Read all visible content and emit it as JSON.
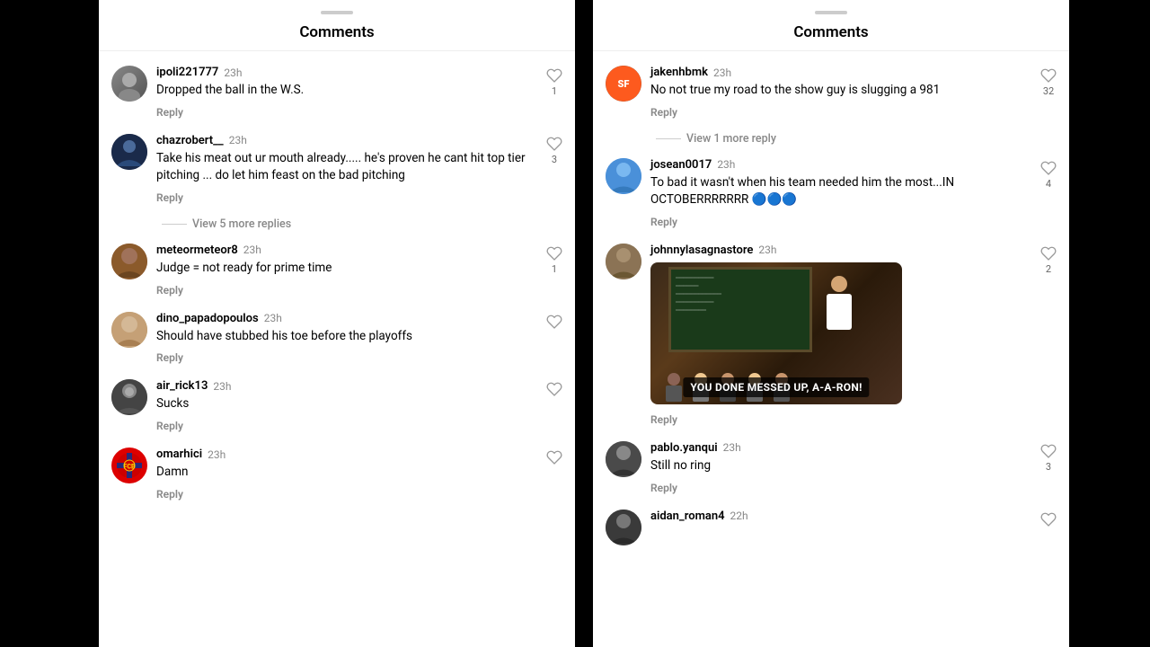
{
  "left_panel": {
    "header": "Comments",
    "comments": [
      {
        "id": "ipoli221977",
        "username": "ipoli221777",
        "timestamp": "23h",
        "text": "Dropped the ball in the W.S.",
        "likes": 1,
        "avatar_type": "ipoli"
      },
      {
        "id": "chazrobert",
        "username": "chazrobert__",
        "timestamp": "23h",
        "text": "Take his meat out ur mouth already..... he's proven he cant hit top tier pitching ... do let him feast on the bad pitching",
        "likes": 3,
        "avatar_type": "chaz",
        "view_more": "View 5 more replies"
      },
      {
        "id": "meteormeteor8",
        "username": "meteormeteor8",
        "timestamp": "23h",
        "text": "Judge = not ready for prime time",
        "likes": 1,
        "avatar_type": "meteor"
      },
      {
        "id": "dino_papadopoulos",
        "username": "dino_papadopoulos",
        "timestamp": "23h",
        "text": "Should have stubbed his toe before the playoffs",
        "likes": 0,
        "avatar_type": "dino"
      },
      {
        "id": "air_rick13",
        "username": "air_rick13",
        "timestamp": "23h",
        "text": "Sucks",
        "likes": 0,
        "avatar_type": "air"
      },
      {
        "id": "omarhici",
        "username": "omarhici",
        "timestamp": "23h",
        "text": "Damn",
        "likes": 0,
        "avatar_type": "omar"
      }
    ]
  },
  "right_panel": {
    "header": "Comments",
    "comments": [
      {
        "id": "jakenhbmk",
        "username": "jakenhbmk",
        "timestamp": "23h",
        "text": "No not true my road to the show guy is slugging a 981",
        "likes": 32,
        "avatar_type": "jake",
        "view_more": "View 1 more reply"
      },
      {
        "id": "josean0017",
        "username": "josean0017",
        "timestamp": "23h",
        "text": "To bad it wasn't when his team needed him the most...IN OCTOBERRRRRRR 🔵🔵🔵",
        "likes": 4,
        "avatar_type": "josean"
      },
      {
        "id": "johnnylasagnastore",
        "username": "johnnylasagnastore",
        "timestamp": "23h",
        "text": "",
        "has_gif": true,
        "gif_caption": "YOU DONE MESSED UP, A-A-RON!",
        "likes": 2,
        "avatar_type": "johnny"
      },
      {
        "id": "pablo_yanqui",
        "username": "pablo.yanqui",
        "timestamp": "23h",
        "text": "Still no ring",
        "likes": 3,
        "avatar_type": "pablo"
      },
      {
        "id": "aidan_roman4",
        "username": "aidan_roman4",
        "timestamp": "22h",
        "text": "",
        "likes": 0,
        "avatar_type": "aidan"
      }
    ]
  },
  "labels": {
    "reply": "Reply",
    "view_more_prefix": "View",
    "view_more_suffix": "more replies",
    "view_1_more": "View 1 more reply"
  }
}
